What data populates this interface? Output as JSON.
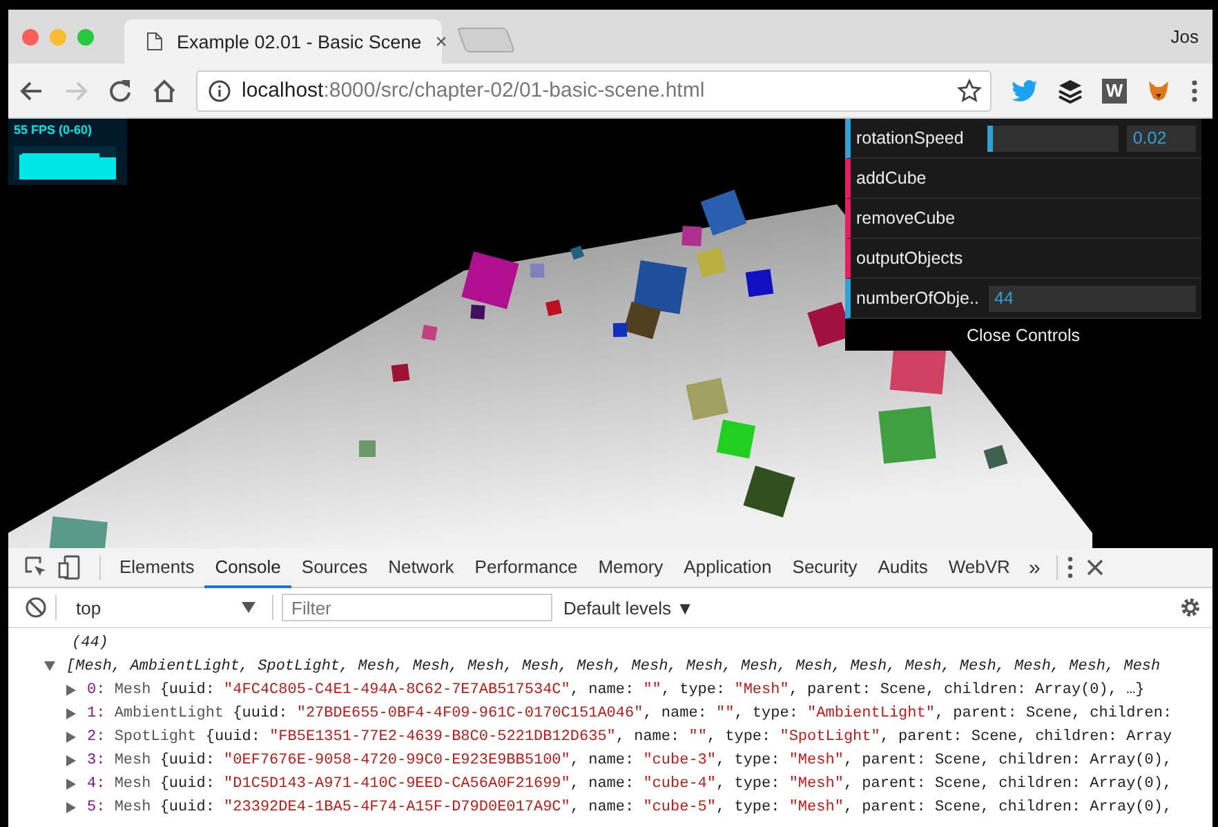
{
  "browser": {
    "tabs": [
      {
        "title": "Example 02.01 - Basic Scene",
        "close": "×"
      }
    ],
    "profile": "Jos",
    "url": {
      "host": "localhost",
      "path": ":8000/src/chapter-02/01-basic-scene.html"
    },
    "extension_letter": "W"
  },
  "stats": {
    "label": "55 FPS (0-60)"
  },
  "gui": {
    "controllers": [
      {
        "kind": "slider",
        "label": "rotationSpeed",
        "level": 0.02,
        "value": "0.02"
      },
      {
        "kind": "function",
        "label": "addCube"
      },
      {
        "kind": "function",
        "label": "removeCube"
      },
      {
        "kind": "function",
        "label": "outputObjects"
      },
      {
        "kind": "number",
        "label": "numberOfObje..",
        "value": "44"
      }
    ],
    "close": "Close Controls"
  },
  "devtools": {
    "tabs": [
      {
        "label": "Elements",
        "selected": false
      },
      {
        "label": "Console",
        "selected": true
      },
      {
        "label": "Sources",
        "selected": false
      },
      {
        "label": "Network",
        "selected": false
      },
      {
        "label": "Performance",
        "selected": false
      },
      {
        "label": "Memory",
        "selected": false
      },
      {
        "label": "Application",
        "selected": false
      },
      {
        "label": "Security",
        "selected": false
      },
      {
        "label": "Audits",
        "selected": false
      },
      {
        "label": "WebVR",
        "selected": false
      }
    ],
    "more": "»",
    "context": "top",
    "filter_placeholder": "Filter",
    "levels": "Default levels ▼",
    "console": {
      "count": "(44)",
      "summary": "[Mesh, AmbientLight, SpotLight, Mesh, Mesh, Mesh, Mesh, Mesh, Mesh, Mesh, Mesh, Mesh, Mesh, Mesh, Mesh, Mesh, Mesh, Mesh",
      "rows": [
        {
          "index": "0:",
          "class": "Mesh",
          "segments": [
            {
              "kind": "plain",
              "text": "{uuid: "
            },
            {
              "kind": "string",
              "text": "\"4FC4C805-C4E1-494A-8C62-7E7AB517534C\""
            },
            {
              "kind": "plain",
              "text": ", name: "
            },
            {
              "kind": "string",
              "text": "\"\""
            },
            {
              "kind": "plain",
              "text": ", type: "
            },
            {
              "kind": "string",
              "text": "\"Mesh\""
            },
            {
              "kind": "plain",
              "text": ", parent: Scene, children: Array(0), …}"
            }
          ]
        },
        {
          "index": "1:",
          "class": "AmbientLight",
          "segments": [
            {
              "kind": "plain",
              "text": "{uuid: "
            },
            {
              "kind": "string",
              "text": "\"27BDE655-0BF4-4F09-961C-0170C151A046\""
            },
            {
              "kind": "plain",
              "text": ", name: "
            },
            {
              "kind": "string",
              "text": "\"\""
            },
            {
              "kind": "plain",
              "text": ", type: "
            },
            {
              "kind": "string",
              "text": "\"AmbientLight\""
            },
            {
              "kind": "plain",
              "text": ", parent: Scene, children:"
            }
          ]
        },
        {
          "index": "2:",
          "class": "SpotLight",
          "segments": [
            {
              "kind": "plain",
              "text": "{uuid: "
            },
            {
              "kind": "string",
              "text": "\"FB5E1351-77E2-4639-B8C0-5221DB12D635\""
            },
            {
              "kind": "plain",
              "text": ", name: "
            },
            {
              "kind": "string",
              "text": "\"\""
            },
            {
              "kind": "plain",
              "text": ", type: "
            },
            {
              "kind": "string",
              "text": "\"SpotLight\""
            },
            {
              "kind": "plain",
              "text": ", parent: Scene, children: Array"
            }
          ]
        },
        {
          "index": "3:",
          "class": "Mesh",
          "segments": [
            {
              "kind": "plain",
              "text": "{uuid: "
            },
            {
              "kind": "string",
              "text": "\"0EF7676E-9058-4720-99C0-E923E9BB5100\""
            },
            {
              "kind": "plain",
              "text": ", name: "
            },
            {
              "kind": "string",
              "text": "\"cube-3\""
            },
            {
              "kind": "plain",
              "text": ", type: "
            },
            {
              "kind": "string",
              "text": "\"Mesh\""
            },
            {
              "kind": "plain",
              "text": ", parent: Scene, children: Array(0),"
            }
          ]
        },
        {
          "index": "4:",
          "class": "Mesh",
          "segments": [
            {
              "kind": "plain",
              "text": "{uuid: "
            },
            {
              "kind": "string",
              "text": "\"D1C5D143-A971-410C-9EED-CA56A0F21699\""
            },
            {
              "kind": "plain",
              "text": ", name: "
            },
            {
              "kind": "string",
              "text": "\"cube-4\""
            },
            {
              "kind": "plain",
              "text": ", type: "
            },
            {
              "kind": "string",
              "text": "\"Mesh\""
            },
            {
              "kind": "plain",
              "text": ", parent: Scene, children: Array(0),"
            }
          ]
        },
        {
          "index": "5:",
          "class": "Mesh",
          "segments": [
            {
              "kind": "plain",
              "text": "{uuid: "
            },
            {
              "kind": "string",
              "text": "\"23392DE4-1BA5-4F74-A15F-D79D0E017A9C\""
            },
            {
              "kind": "plain",
              "text": ", name: "
            },
            {
              "kind": "string",
              "text": "\"cube-5\""
            },
            {
              "kind": "plain",
              "text": ", type: "
            },
            {
              "kind": "string",
              "text": "\"Mesh\""
            },
            {
              "kind": "plain",
              "text": ", parent: Scene, children: Array(0),"
            }
          ]
        }
      ]
    }
  }
}
